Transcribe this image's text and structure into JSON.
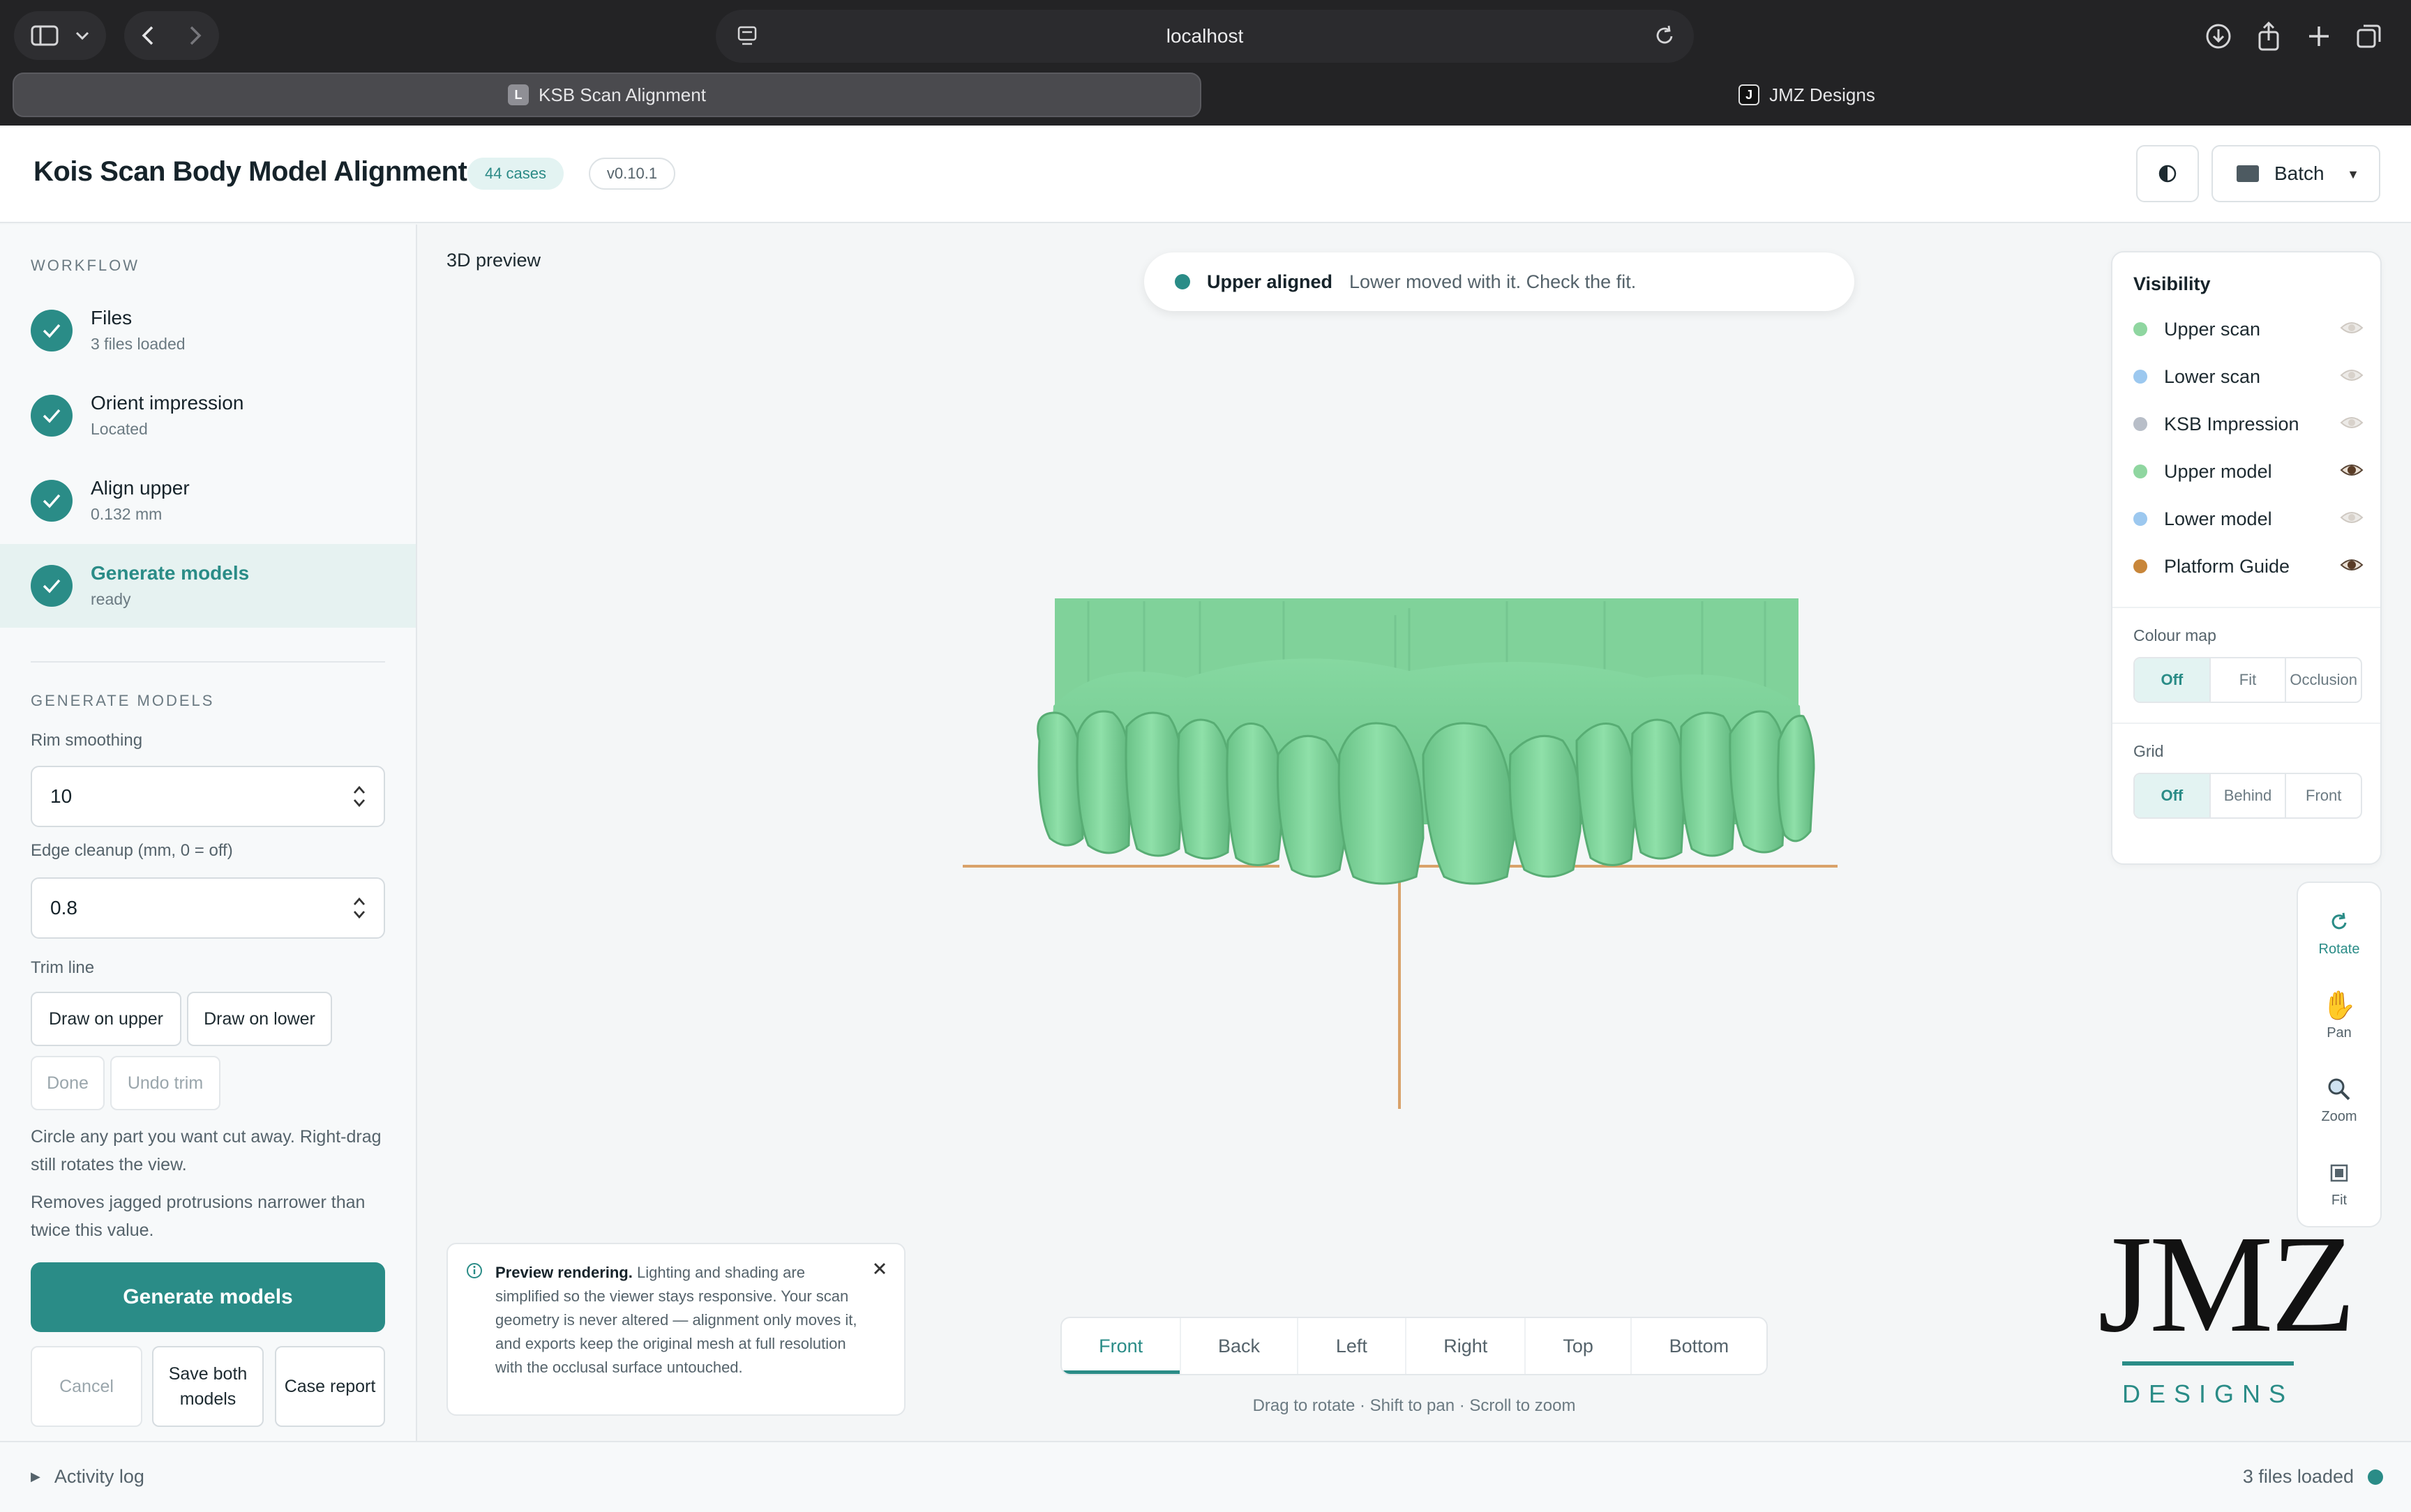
{
  "browser": {
    "url": "localhost",
    "tabs": [
      {
        "label": "KSB Scan Alignment",
        "favicon": "L"
      },
      {
        "label": "JMZ Designs",
        "favicon": "J"
      }
    ]
  },
  "header": {
    "title": "Kois Scan Body Model Alignment",
    "cases_badge": "44 cases",
    "version_badge": "v0.10.1",
    "batch_label": "Batch"
  },
  "sidebar": {
    "workflow_label": "WORKFLOW",
    "steps": [
      {
        "title": "Files",
        "sub": "3 files loaded"
      },
      {
        "title": "Orient impression",
        "sub": "Located"
      },
      {
        "title": "Align upper",
        "sub": "0.132 mm"
      },
      {
        "title": "Generate models",
        "sub": "ready"
      }
    ],
    "generate_label": "GENERATE MODELS",
    "rim_smoothing_label": "Rim smoothing",
    "rim_smoothing_value": "10",
    "edge_cleanup_label": "Edge cleanup (mm, 0 = off)",
    "edge_cleanup_value": "0.8",
    "trim_label": "Trim line",
    "draw_upper": "Draw on upper",
    "draw_lower": "Draw on lower",
    "done": "Done",
    "undo_trim": "Undo trim",
    "help1": "Circle any part you want cut away. Right-drag still rotates the view.",
    "help2": "Removes jagged protrusions narrower than twice this value.",
    "generate_button": "Generate models",
    "cancel": "Cancel",
    "save_both": "Save both models",
    "case_report": "Case report"
  },
  "viewport": {
    "label": "3D preview",
    "toast_title": "Upper aligned",
    "toast_msg": "Lower moved with it. Check the fit.",
    "info_title": "Preview rendering.",
    "info_body": " Lighting and shading are simplified so the viewer stays responsive. Your scan geometry is never altered — alignment only moves it, and exports keep the original mesh at full resolution with the occlusal surface untouched.",
    "views": [
      "Front",
      "Back",
      "Left",
      "Right",
      "Top",
      "Bottom"
    ],
    "active_view": "Front",
    "hint": "Drag to rotate · Shift to pan · Scroll to zoom"
  },
  "visibility": {
    "title": "Visibility",
    "layers": [
      {
        "name": "Upper scan",
        "color": "#8fd6a0",
        "visible": false
      },
      {
        "name": "Lower scan",
        "color": "#9cc8ef",
        "visible": false
      },
      {
        "name": "KSB Impression",
        "color": "#b8bec8",
        "visible": false
      },
      {
        "name": "Upper model",
        "color": "#8fd6a0",
        "visible": true
      },
      {
        "name": "Lower model",
        "color": "#9cc8ef",
        "visible": false
      },
      {
        "name": "Platform Guide",
        "color": "#c8863a",
        "visible": true
      }
    ],
    "colour_map_label": "Colour map",
    "colour_map": [
      "Off",
      "Fit",
      "Occlusion"
    ],
    "grid_label": "Grid",
    "grid": [
      "Off",
      "Behind",
      "Front"
    ]
  },
  "tools": [
    {
      "label": "Rotate",
      "icon": "rotate-icon",
      "active": true
    },
    {
      "label": "Pan",
      "icon": "hand-icon",
      "active": false
    },
    {
      "label": "Zoom",
      "icon": "magnifier-icon",
      "active": false
    },
    {
      "label": "Fit",
      "icon": "fit-icon",
      "active": false
    }
  ],
  "logo": {
    "main": "JMZ",
    "sub": "DESIGNS"
  },
  "footer": {
    "activity": "Activity log",
    "status": "3 files loaded"
  },
  "colors": {
    "accent": "#2a8c87",
    "model_green": "#7fd49b",
    "guide": "#d9a26a"
  }
}
